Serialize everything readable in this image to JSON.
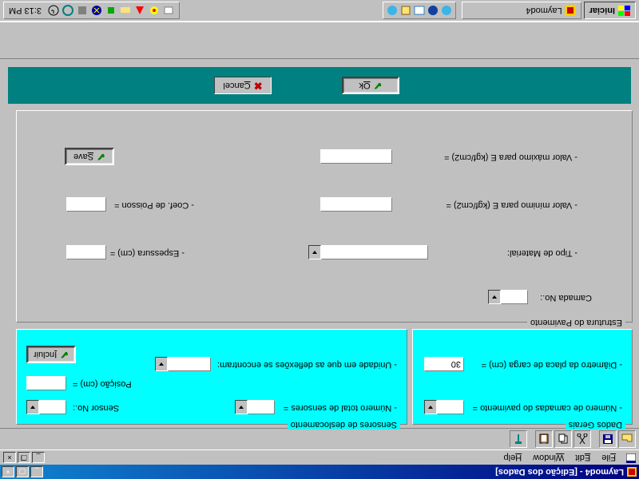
{
  "window": {
    "title": "Laymod4 - [Edição dos Dados]"
  },
  "menu": {
    "file": "File",
    "edit": "Edit",
    "window": "Window",
    "help": "Help"
  },
  "groups": {
    "sensores": {
      "title": "Sensores de deslocamento",
      "sensor_no": "Sensor No.:",
      "posicao": "Posição (cm) =",
      "numero_total": "- Número total de sensores =",
      "unidade": "- Unidade em que as deflexões se encontram:",
      "incluir_btn": "Incluir"
    },
    "dados": {
      "title": "Dados Gerais",
      "numero_camadas": "- Número de camadas do pavimento =",
      "diametro": "- Diâmetro da placa de carga (cm) =",
      "diametro_value": "30"
    },
    "estrutura": {
      "title": "Estrutura do Pavimento",
      "camada_no": "Camada No.:",
      "tipo_material": "- Tipo de Material:",
      "espessura": "- Espessura (cm) =",
      "valor_min": "- Valor mínimo para E (kgf/cm2) =",
      "coef_poisson": "- Coef. de Poisson =",
      "valor_max": "- Valor máximo para E (kgf/cm2) =",
      "save_btn": "Save"
    }
  },
  "dialog": {
    "ok": "Ok",
    "cancel": "Cancel"
  },
  "taskbar": {
    "start": "Iniciar",
    "app": "Laymod4",
    "clock": "3:13 PM"
  }
}
